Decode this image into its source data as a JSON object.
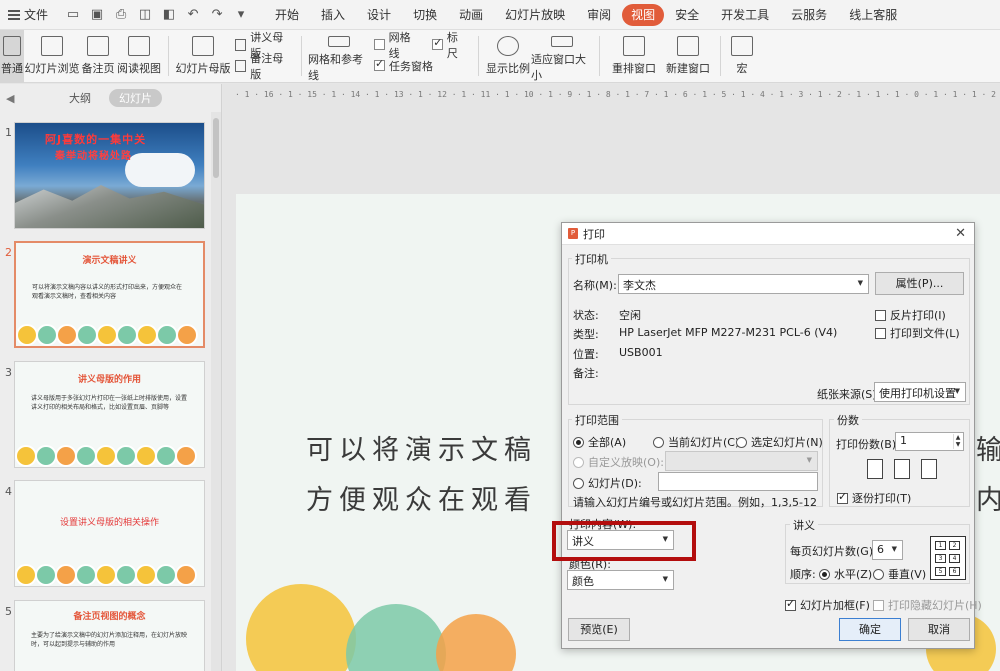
{
  "menubar": {
    "file_label": "文件",
    "tabs": [
      "开始",
      "插入",
      "设计",
      "切换",
      "动画",
      "幻灯片放映",
      "审阅",
      "视图",
      "安全",
      "开发工具",
      "云服务",
      "线上客服"
    ],
    "active_tab": "视图"
  },
  "ribbon": {
    "normal": "普通",
    "slide_sorter": "幻灯片浏览",
    "notes_page": "备注页",
    "reading_view": "阅读视图",
    "slide_master": "幻灯片母版",
    "handout_master": "讲义母版",
    "notes_master": "备注母版",
    "grid_guides": "网格和参考线",
    "gridlines": "网格线",
    "ruler": "标尺",
    "task_pane": "任务窗格",
    "zoom": "显示比例",
    "fit_window": "适应窗口大小",
    "arrange_all": "重排窗口",
    "new_window": "新建窗口",
    "macro": "宏"
  },
  "left_panel": {
    "tab_outline": "大纲",
    "tab_slides": "幻灯片",
    "slides": [
      {
        "num": "1",
        "title_line1": "阿J喜数的一集中关",
        "title_line2": "秦举动将秘处路"
      },
      {
        "num": "2",
        "title": "演示文稿讲义",
        "body": "可以将演示文稿内容以讲义的形式打印出来，方便观众在观看演示文稿时，查看相关内容"
      },
      {
        "num": "3",
        "title": "讲义母版的作用",
        "body": "讲义母版用于多张幻灯片打印在一张纸上时排版使用，设置讲义打印的相关布局和格式，比如设置页眉、页脚等"
      },
      {
        "num": "4",
        "title": "设置讲义母版的相关操作"
      },
      {
        "num": "5",
        "title": "备注页视图的概念",
        "body": "主要为了给演示文稿中的幻灯片添加注释用，在幻灯片放映时，可以起到提示与辅助的作用"
      }
    ]
  },
  "ruler_text": "· 1 · 16 · 1 · 15 · 1 · 14 · 1 · 13 · 1 · 12 · 1 · 11 · 1 · 10 · 1 · 9 · 1 · 8 · 1 · 7 · 1 · 6 · 1 · 5 · 1 · 4 · 1 · 3 · 1 · 2 · 1 · 1 · 1 · 0 · 1 · 1 · 1 · 2 · 1 · 3 · 1 · 4 · 1 · 5 · 1 · 6 · 1 · 7 · 1 · 8",
  "canvas": {
    "line1": "可以将演示文稿",
    "line1_end": "输",
    "line2": "方便观众在观看",
    "line2_end": "内"
  },
  "dialog": {
    "title": "打印",
    "printer_group": "打印机",
    "name_label": "名称(M):",
    "name_value": "李文杰",
    "properties_btn": "属性(P)...",
    "status_label": "状态:",
    "status_value": "空闲",
    "type_label": "类型:",
    "type_value": "HP LaserJet MFP M227-M231 PCL-6 (V4)",
    "where_label": "位置:",
    "where_value": "USB001",
    "comment_label": "备注:",
    "reverse_print": "反片打印(I)",
    "print_to_file": "打印到文件(L)",
    "paper_source_label": "纸张来源(S):",
    "paper_source_value": "使用打印机设置",
    "range_group": "打印范围",
    "range_all": "全部(A)",
    "range_current": "当前幻灯片(C)",
    "range_selection": "选定幻灯片(N)",
    "range_custom": "自定义放映(O):",
    "range_slides": "幻灯片(D):",
    "range_hint": "请输入幻灯片编号或幻灯片范围。例如，1,3,5-12",
    "copies_group": "份数",
    "copies_label": "打印份数(B):",
    "copies_value": "1",
    "collate": "逐份打印(T)",
    "print_what_label": "打印内容(W):",
    "print_what_value": "讲义",
    "color_label": "颜色(R):",
    "color_value": "颜色",
    "handout_group": "讲义",
    "per_page_label": "每页幻灯片数(G):",
    "per_page_value": "6",
    "order_label": "顺序:",
    "order_horizontal": "水平(Z)",
    "order_vertical": "垂直(V)",
    "frame_slides": "幻灯片加框(F)",
    "print_hidden": "打印隐藏幻灯片(H)",
    "preview_btn": "预览(E)",
    "ok_btn": "确定",
    "cancel_btn": "取消",
    "grid_numbers": [
      "1",
      "2",
      "3",
      "4",
      "5",
      "6"
    ]
  },
  "colors": {
    "accent": "#e15c3a",
    "highlight": "#b30d0d"
  }
}
